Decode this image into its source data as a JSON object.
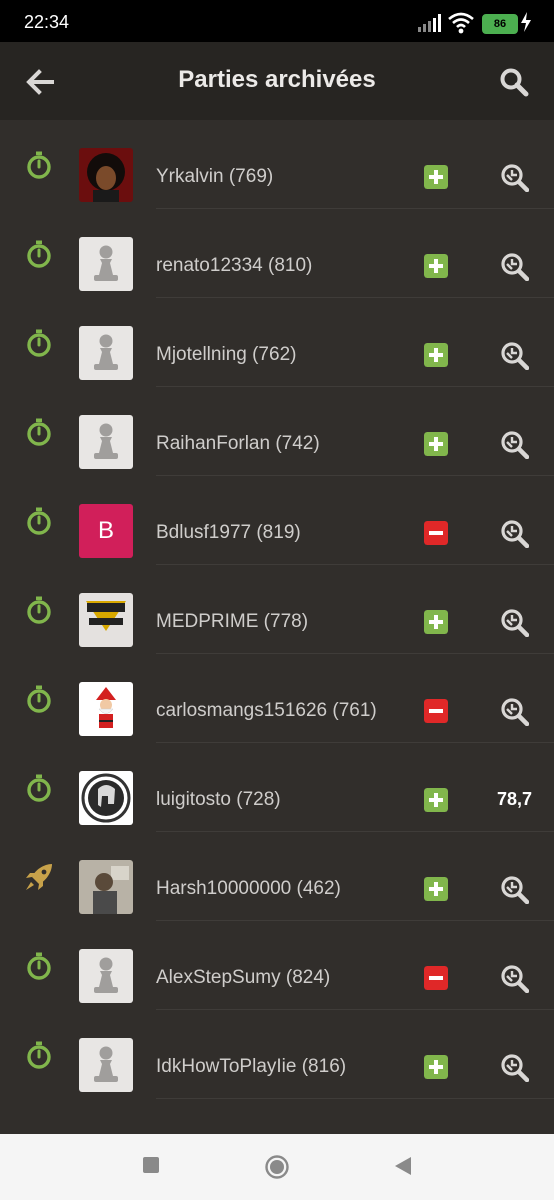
{
  "status_bar": {
    "time": "22:34",
    "battery": "86"
  },
  "header": {
    "title": "Parties archivées"
  },
  "colors": {
    "win": "#81b64c",
    "loss": "#e02828",
    "mode_green": "#81b64c",
    "mode_gold": "#c8a24a"
  },
  "games": [
    {
      "mode_icon": "stopwatch-icon",
      "avatar": "avatar-afro-cartoon",
      "name": "Yrkalvin (769)",
      "result": "plus-icon",
      "action": "analysis-magnifier-icon"
    },
    {
      "mode_icon": "stopwatch-icon",
      "avatar": "avatar-default-pawn",
      "name": "renato12334 (810)",
      "result": "plus-icon",
      "action": "analysis-magnifier-icon"
    },
    {
      "mode_icon": "stopwatch-icon",
      "avatar": "avatar-default-pawn",
      "name": "Mjotellning (762)",
      "result": "plus-icon",
      "action": "analysis-magnifier-icon"
    },
    {
      "mode_icon": "stopwatch-icon",
      "avatar": "avatar-default-pawn",
      "name": "RaihanForlan (742)",
      "result": "plus-icon",
      "action": "analysis-magnifier-icon"
    },
    {
      "mode_icon": "stopwatch-icon",
      "avatar": "avatar-letter",
      "avatar_letter": "B",
      "name": "Bdlusf1977 (819)",
      "result": "minus-icon",
      "action": "analysis-magnifier-icon"
    },
    {
      "mode_icon": "stopwatch-icon",
      "avatar": "avatar-medprime-logo",
      "name": "MEDPRIME (778)",
      "result": "plus-icon",
      "action": "analysis-magnifier-icon"
    },
    {
      "mode_icon": "stopwatch-icon",
      "avatar": "avatar-santa",
      "name": "carlosmangs151626 (761)",
      "result": "minus-icon",
      "action": "analysis-magnifier-icon"
    },
    {
      "mode_icon": "stopwatch-icon",
      "avatar": "avatar-spartan-helmet",
      "name": "luigitosto (728)",
      "result": "plus-icon",
      "action": "accuracy",
      "accuracy": "78,7"
    },
    {
      "mode_icon": "rocket-icon",
      "avatar": "avatar-photo",
      "name": "Harsh10000000 (462)",
      "result": "plus-icon",
      "action": "analysis-magnifier-icon"
    },
    {
      "mode_icon": "stopwatch-icon",
      "avatar": "avatar-default-pawn",
      "name": "AlexStepSumy (824)",
      "result": "minus-icon",
      "action": "analysis-magnifier-icon"
    },
    {
      "mode_icon": "stopwatch-icon",
      "avatar": "avatar-default-pawn",
      "name": "IdkHowToPlayIie (816)",
      "result": "plus-icon",
      "action": "analysis-magnifier-icon"
    }
  ]
}
